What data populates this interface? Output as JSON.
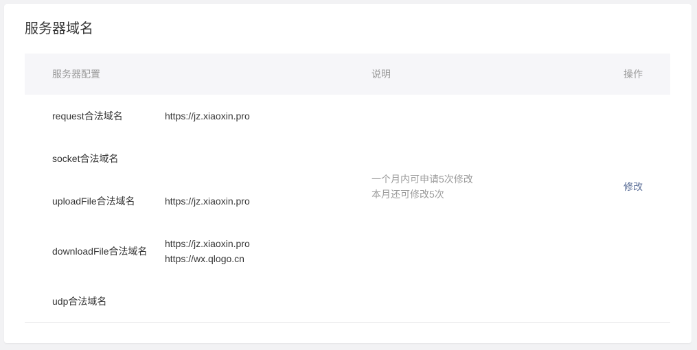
{
  "card": {
    "title": "服务器域名"
  },
  "table": {
    "headers": {
      "config": "服务器配置",
      "description": "说明",
      "operation": "操作"
    },
    "rows": [
      {
        "label": "request合法域名",
        "values": [
          "https://jz.xiaoxin.pro"
        ]
      },
      {
        "label": "socket合法域名",
        "values": []
      },
      {
        "label": "uploadFile合法域名",
        "values": [
          "https://jz.xiaoxin.pro"
        ]
      },
      {
        "label": "downloadFile合法域名",
        "values": [
          "https://jz.xiaoxin.pro",
          "https://wx.qlogo.cn"
        ]
      },
      {
        "label": "udp合法域名",
        "values": []
      }
    ],
    "description_lines": [
      "一个月内可申请5次修改",
      "本月还可修改5次"
    ],
    "operation_label": "修改"
  },
  "colors": {
    "link": "#576b95",
    "header_bg": "#f6f6f9",
    "muted_text": "#9a9a9a",
    "body_text": "#353535"
  }
}
